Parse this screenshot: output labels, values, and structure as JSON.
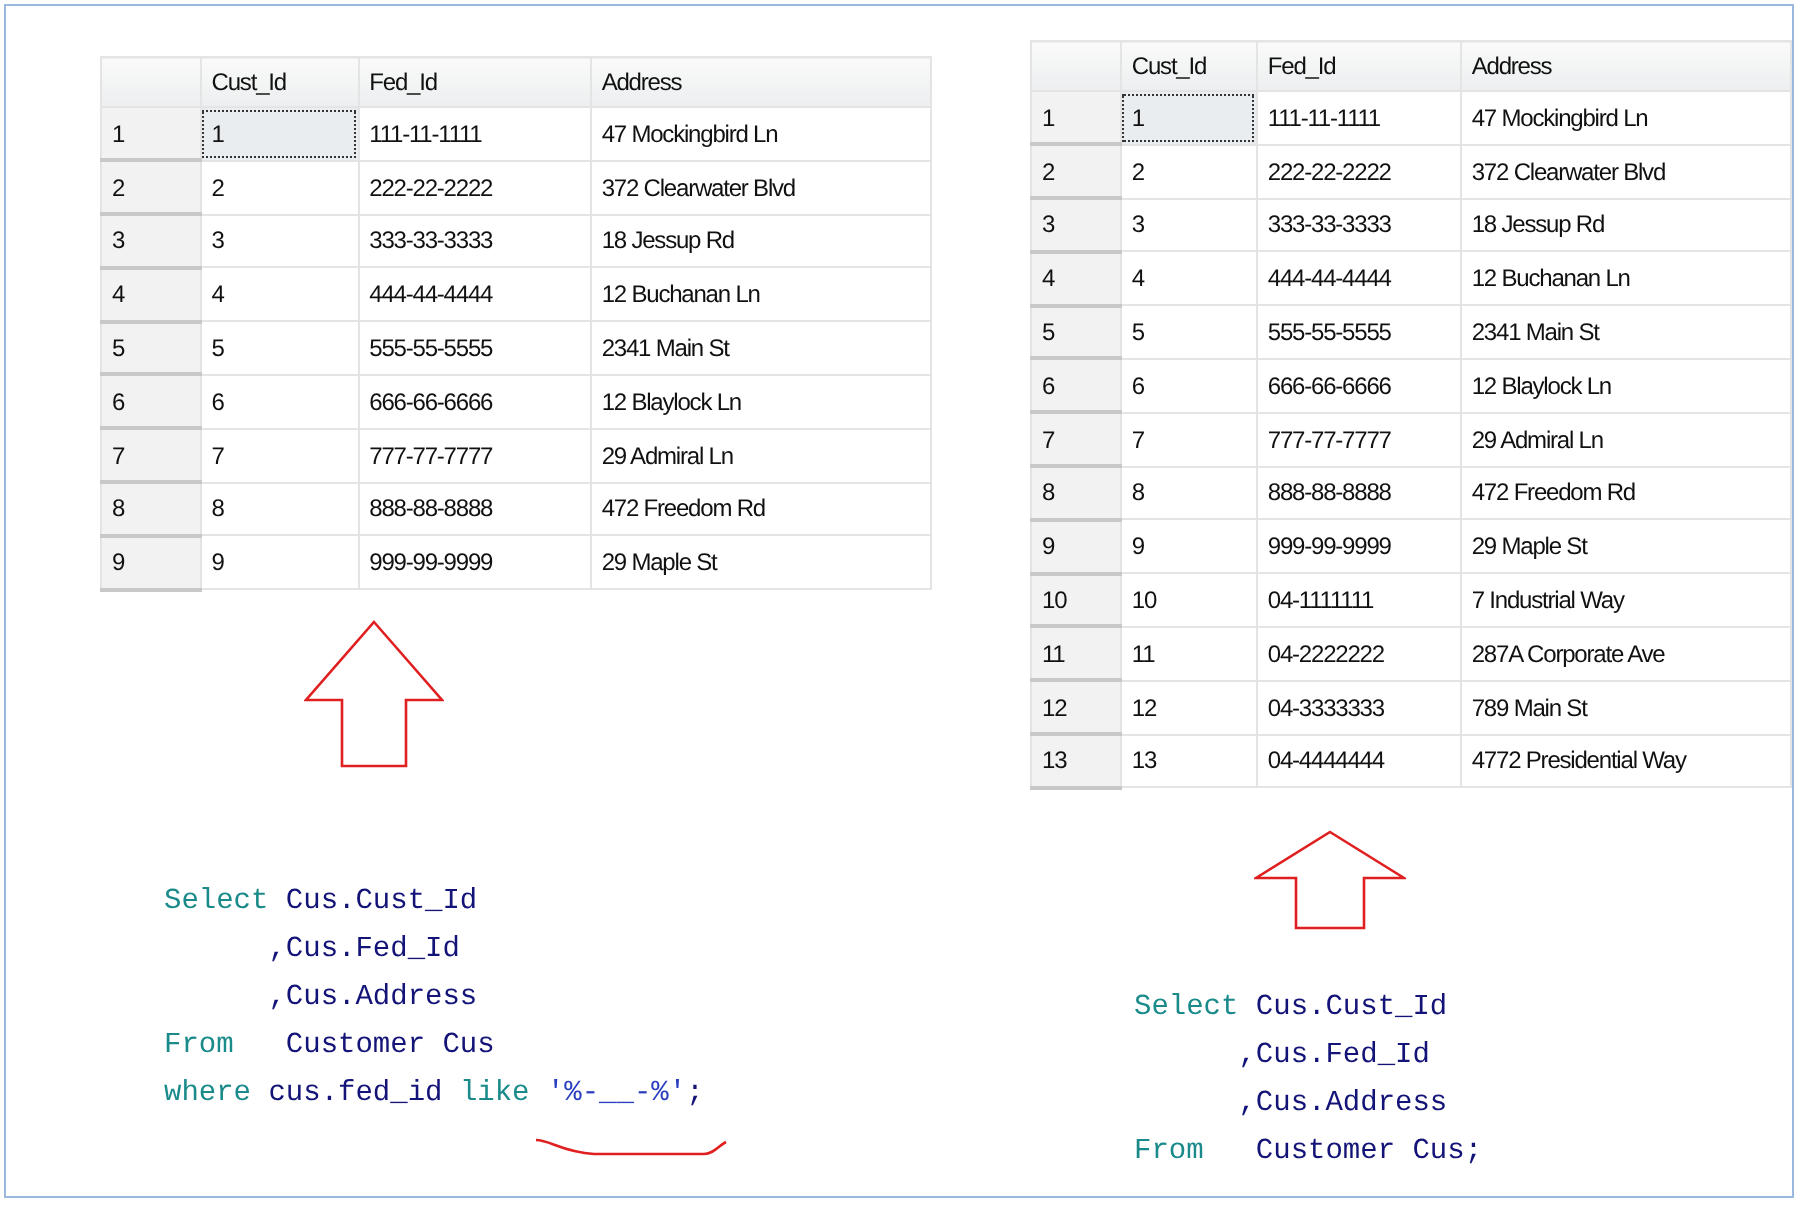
{
  "left_panel": {
    "grid": {
      "columns": [
        "Cust_Id",
        "Fed_Id",
        "Address"
      ],
      "rows": [
        {
          "number": "1",
          "cells": [
            "1",
            "111-11-1111",
            "47 Mockingbird Ln"
          ],
          "focused": true
        },
        {
          "number": "2",
          "cells": [
            "2",
            "222-22-2222",
            "372 Clearwater Blvd"
          ],
          "focused": false
        },
        {
          "number": "3",
          "cells": [
            "3",
            "333-33-3333",
            "18 Jessup Rd"
          ],
          "focused": false
        },
        {
          "number": "4",
          "cells": [
            "4",
            "444-44-4444",
            "12 Buchanan Ln"
          ],
          "focused": false
        },
        {
          "number": "5",
          "cells": [
            "5",
            "555-55-5555",
            "2341 Main St"
          ],
          "focused": false
        },
        {
          "number": "6",
          "cells": [
            "6",
            "666-66-6666",
            "12 Blaylock Ln"
          ],
          "focused": false
        },
        {
          "number": "7",
          "cells": [
            "7",
            "777-77-7777",
            "29 Admiral Ln"
          ],
          "focused": false
        },
        {
          "number": "8",
          "cells": [
            "8",
            "888-88-8888",
            "472 Freedom Rd"
          ],
          "focused": false
        },
        {
          "number": "9",
          "cells": [
            "9",
            "999-99-9999",
            "29 Maple St"
          ],
          "focused": false
        }
      ]
    },
    "query": {
      "lines": [
        [
          {
            "kind": "keyword",
            "text": "Select"
          },
          {
            "kind": "ident",
            "text": " Cus.Cust_Id"
          }
        ],
        [
          {
            "kind": "ident",
            "text": "      ,Cus.Fed_Id"
          }
        ],
        [
          {
            "kind": "ident",
            "text": "      ,Cus.Address"
          }
        ],
        [
          {
            "kind": "keyword",
            "text": "From"
          },
          {
            "kind": "ident",
            "text": "   Customer Cus"
          }
        ],
        [
          {
            "kind": "keyword",
            "text": "where"
          },
          {
            "kind": "ident",
            "text": " cus.fed_id "
          },
          {
            "kind": "keyword",
            "text": "like"
          },
          {
            "kind": "string",
            "text": " '%-__-%'"
          },
          {
            "kind": "ident",
            "text": ";"
          }
        ]
      ]
    }
  },
  "right_panel": {
    "grid": {
      "columns": [
        "Cust_Id",
        "Fed_Id",
        "Address"
      ],
      "rows": [
        {
          "number": "1",
          "cells": [
            "1",
            "111-11-1111",
            "47 Mockingbird Ln"
          ],
          "focused": true
        },
        {
          "number": "2",
          "cells": [
            "2",
            "222-22-2222",
            "372 Clearwater Blvd"
          ],
          "focused": false
        },
        {
          "number": "3",
          "cells": [
            "3",
            "333-33-3333",
            "18 Jessup Rd"
          ],
          "focused": false
        },
        {
          "number": "4",
          "cells": [
            "4",
            "444-44-4444",
            "12 Buchanan Ln"
          ],
          "focused": false
        },
        {
          "number": "5",
          "cells": [
            "5",
            "555-55-5555",
            "2341 Main St"
          ],
          "focused": false
        },
        {
          "number": "6",
          "cells": [
            "6",
            "666-66-6666",
            "12 Blaylock Ln"
          ],
          "focused": false
        },
        {
          "number": "7",
          "cells": [
            "7",
            "777-77-7777",
            "29 Admiral Ln"
          ],
          "focused": false
        },
        {
          "number": "8",
          "cells": [
            "8",
            "888-88-8888",
            "472 Freedom Rd"
          ],
          "focused": false
        },
        {
          "number": "9",
          "cells": [
            "9",
            "999-99-9999",
            "29 Maple St"
          ],
          "focused": false
        },
        {
          "number": "10",
          "cells": [
            "10",
            "04-1111111",
            "7 Industrial Way"
          ],
          "focused": false
        },
        {
          "number": "11",
          "cells": [
            "11",
            "04-2222222",
            "287A Corporate Ave"
          ],
          "focused": false
        },
        {
          "number": "12",
          "cells": [
            "12",
            "04-3333333",
            "789 Main St"
          ],
          "focused": false
        },
        {
          "number": "13",
          "cells": [
            "13",
            "04-4444444",
            "4772 Presidential Way"
          ],
          "focused": false
        }
      ]
    },
    "query": {
      "lines": [
        [
          {
            "kind": "keyword",
            "text": "Select"
          },
          {
            "kind": "ident",
            "text": " Cus.Cust_Id"
          }
        ],
        [
          {
            "kind": "ident",
            "text": "      ,Cus.Fed_Id"
          }
        ],
        [
          {
            "kind": "ident",
            "text": "      ,Cus.Address"
          }
        ],
        [
          {
            "kind": "keyword",
            "text": "From"
          },
          {
            "kind": "ident",
            "text": "   Customer Cus;"
          }
        ]
      ]
    }
  }
}
